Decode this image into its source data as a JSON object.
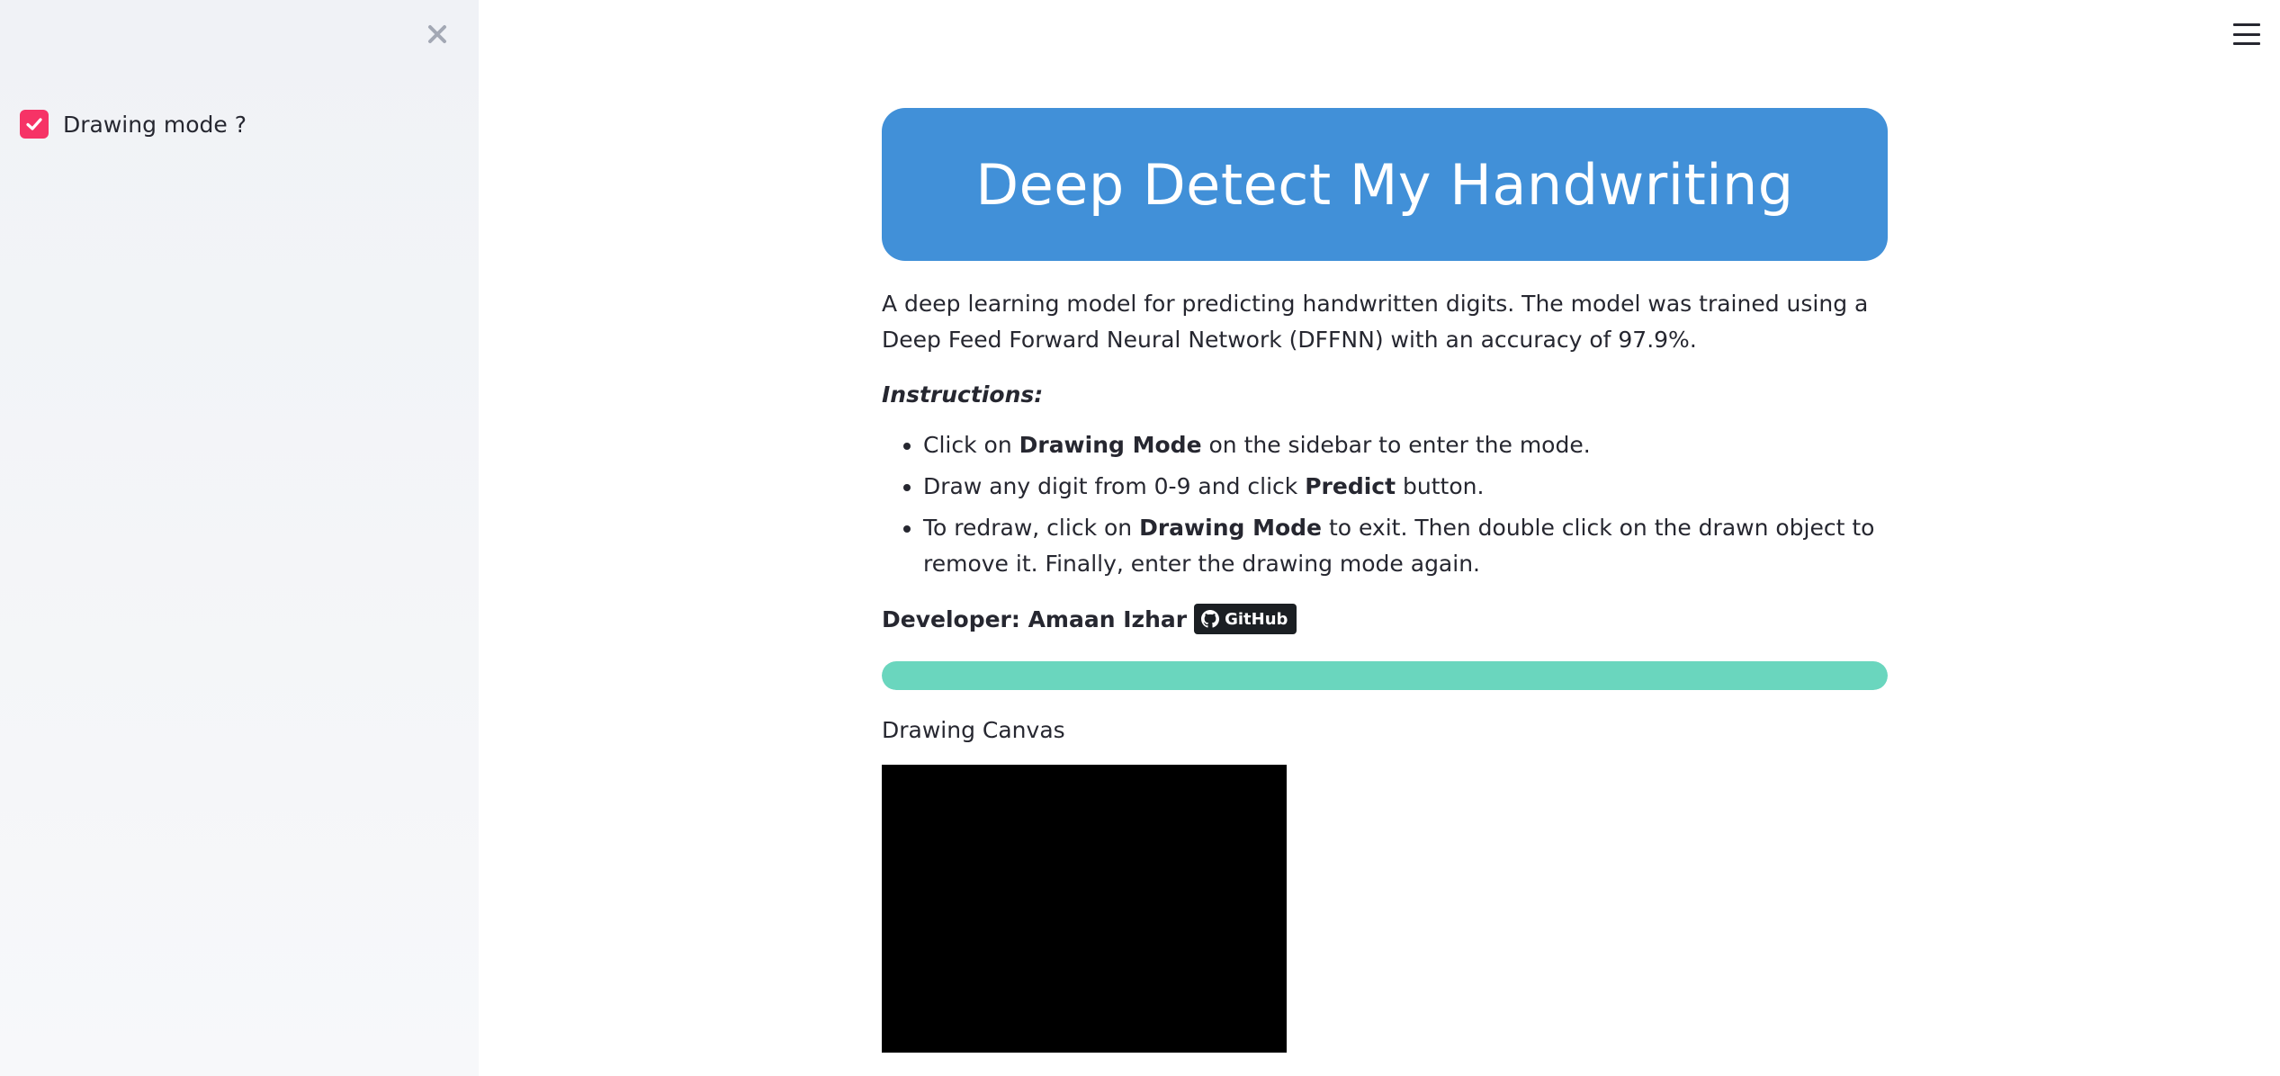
{
  "sidebar": {
    "close_icon": "close-icon",
    "checkbox": {
      "label": "Drawing mode ?",
      "checked": true,
      "color": "#f63366"
    }
  },
  "header": {
    "menu_icon": "hamburger-icon"
  },
  "main": {
    "title": "Deep Detect My Handwriting",
    "title_bg": "#4190d8",
    "description": "A deep learning model for predicting handwritten digits. The model was trained using a Deep Feed Forward Neural Network (DFFNN) with an accuracy of 97.9%.",
    "instructions_heading": "Instructions:",
    "instructions": [
      {
        "pre": "Click on ",
        "bold": "Drawing Mode",
        "post": " on the sidebar to enter the mode."
      },
      {
        "pre": "Draw any digit from 0-9 and click ",
        "bold": "Predict",
        "post": " button."
      },
      {
        "pre": "To redraw, click on ",
        "bold": "Drawing Mode",
        "post": " to exit. Then double click on the drawn object to remove it. Finally, enter the drawing mode again."
      }
    ],
    "developer_label": "Developer: Amaan Izhar",
    "github_badge": "GitHub",
    "progress": {
      "value": 1.0,
      "color": "#6ad6be"
    },
    "canvas_label": "Drawing Canvas"
  }
}
